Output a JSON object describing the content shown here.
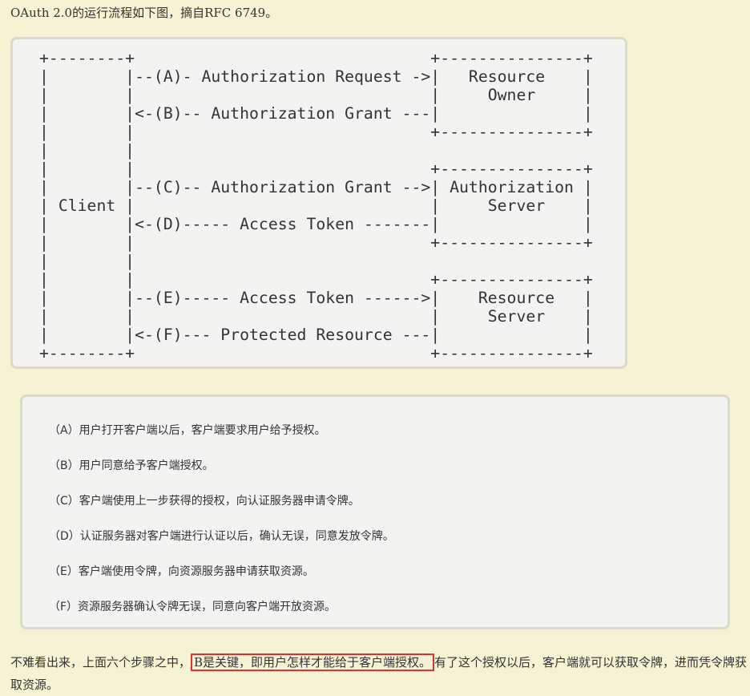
{
  "intro": {
    "text": "OAuth 2.0的运行流程如下图，摘自RFC 6749。"
  },
  "diagram": {
    "ascii": "+--------+                               +---------------+\n|        |--(A)- Authorization Request ->|   Resource    |\n|        |                               |     Owner     |\n|        |<-(B)-- Authorization Grant ---|               |\n|        |                               +---------------+\n|        |\n|        |                               +---------------+\n|        |--(C)-- Authorization Grant -->| Authorization |\n| Client |                               |     Server    |\n|        |<-(D)----- Access Token -------|               |\n|        |                               +---------------+\n|        |\n|        |                               +---------------+\n|        |--(E)----- Access Token ------>|    Resource   |\n|        |                               |     Server    |\n|        |<-(F)--- Protected Resource ---|               |\n+--------+                               +---------------+"
  },
  "steps": [
    "（A）用户打开客户端以后，客户端要求用户给予授权。",
    "（B）用户同意给予客户端授权。",
    "（C）客户端使用上一步获得的授权，向认证服务器申请令牌。",
    "（D）认证服务器对客户端进行认证以后，确认无误，同意发放令牌。",
    "（E）客户端使用令牌，向资源服务器申请获取资源。",
    "（F）资源服务器确认令牌无误，同意向客户端开放资源。"
  ],
  "conclusion": {
    "before": "不难看出来，上面六个步骤之中，",
    "highlight": "B是关键，即用户怎样才能给于客户端授权。",
    "after": "有了这个授权以后，客户端就可以获取令牌，进而凭令牌获取资源。"
  },
  "colors": {
    "page_background": "#f5f3d4",
    "box_background": "#f3f3f1",
    "box_border": "#d8dacb",
    "highlight_border": "#e03030"
  }
}
